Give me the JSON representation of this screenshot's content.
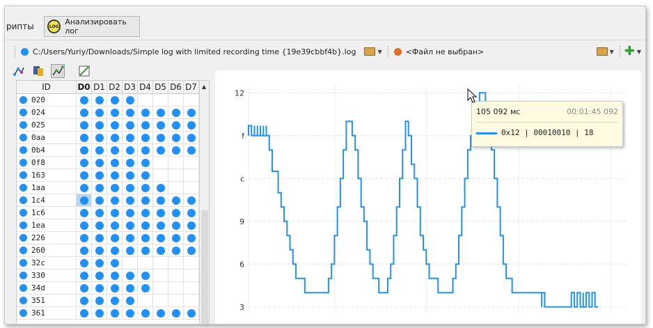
{
  "toolbar": {
    "scripts_label": "рипты",
    "analyze_label": "Анализировать лог",
    "analyze_icon_text": "LOG"
  },
  "pathbar": {
    "file1_path": "C:/Users/Yuriy/Downloads/Simple log with limited recording time {19e39cbbf4b}.log",
    "file1_color": "#1e90ff",
    "file2_label": "<Файл не выбран>",
    "file2_color": "#e07020"
  },
  "table": {
    "headers": [
      "ID",
      "D0",
      "D1",
      "D2",
      "D3",
      "D4",
      "D5",
      "D6",
      "D7"
    ],
    "rows": [
      {
        "id": "020",
        "bits": [
          1,
          1,
          1,
          1,
          0,
          0,
          0,
          0
        ]
      },
      {
        "id": "024",
        "bits": [
          1,
          1,
          1,
          1,
          1,
          1,
          1,
          1
        ]
      },
      {
        "id": "025",
        "bits": [
          1,
          1,
          1,
          1,
          1,
          1,
          1,
          1
        ]
      },
      {
        "id": "0aa",
        "bits": [
          1,
          1,
          1,
          1,
          1,
          1,
          1,
          1
        ]
      },
      {
        "id": "0b4",
        "bits": [
          1,
          1,
          1,
          1,
          1,
          1,
          1,
          1
        ]
      },
      {
        "id": "0f8",
        "bits": [
          1,
          1,
          1,
          1,
          1,
          0,
          0,
          0
        ]
      },
      {
        "id": "163",
        "bits": [
          1,
          1,
          1,
          1,
          1,
          0,
          0,
          0
        ]
      },
      {
        "id": "1aa",
        "bits": [
          1,
          1,
          1,
          1,
          1,
          1,
          0,
          0
        ]
      },
      {
        "id": "1c4",
        "bits": [
          1,
          1,
          1,
          1,
          1,
          1,
          1,
          1
        ],
        "highlight_col": 0
      },
      {
        "id": "1c6",
        "bits": [
          1,
          1,
          1,
          1,
          1,
          1,
          1,
          1
        ]
      },
      {
        "id": "1ea",
        "bits": [
          1,
          1,
          1,
          1,
          1,
          1,
          1,
          1
        ]
      },
      {
        "id": "226",
        "bits": [
          1,
          1,
          1,
          1,
          1,
          1,
          1,
          1
        ]
      },
      {
        "id": "260",
        "bits": [
          1,
          1,
          1,
          1,
          1,
          1,
          1,
          1
        ]
      },
      {
        "id": "32c",
        "bits": [
          1,
          1,
          1,
          0,
          0,
          0,
          0,
          0
        ]
      },
      {
        "id": "330",
        "bits": [
          1,
          1,
          1,
          1,
          1,
          0,
          0,
          0
        ]
      },
      {
        "id": "34d",
        "bits": [
          1,
          1,
          1,
          1,
          1,
          0,
          0,
          0
        ]
      },
      {
        "id": "351",
        "bits": [
          1,
          1,
          1,
          1,
          0,
          0,
          0,
          0
        ]
      },
      {
        "id": "361",
        "bits": [
          1,
          1,
          1,
          1,
          1,
          1,
          1,
          1
        ]
      }
    ]
  },
  "tooltip": {
    "time_ms": "105 092 мс",
    "timestamp": "00:01:45 092",
    "value_text": "0x12 | 00010010 | 18"
  },
  "chart_data": {
    "type": "line",
    "title": "",
    "xlabel": "",
    "ylabel": "",
    "ylim": [
      2.5,
      12.5
    ],
    "yticks": [
      {
        "value": 12,
        "label": "12"
      },
      {
        "value": 9,
        "label": "f"
      },
      {
        "value": 6,
        "label": "c"
      },
      {
        "value": 3,
        "label": "9"
      },
      {
        "value": 0,
        "label": "6"
      },
      {
        "value": -3,
        "label": "3"
      }
    ],
    "series": [
      {
        "color": "#1e90ff",
        "points": [
          [
            0,
            9.7
          ],
          [
            0,
            9
          ],
          [
            0,
            9.7
          ],
          [
            0,
            9
          ],
          [
            0,
            9.7
          ],
          [
            1,
            9
          ],
          [
            2,
            9.7
          ],
          [
            2,
            9
          ],
          [
            3,
            9.7
          ],
          [
            3,
            9
          ],
          [
            4,
            9.7
          ],
          [
            4,
            9
          ],
          [
            5,
            9.7
          ],
          [
            5,
            9
          ],
          [
            6,
            9.7
          ],
          [
            6,
            9
          ],
          [
            7,
            9
          ],
          [
            7,
            8
          ],
          [
            8,
            8
          ],
          [
            8,
            6.5
          ],
          [
            9,
            6.5
          ],
          [
            10,
            5
          ],
          [
            11,
            4
          ],
          [
            12,
            3
          ],
          [
            13,
            2
          ],
          [
            14,
            1
          ],
          [
            15,
            0
          ],
          [
            16,
            -1
          ],
          [
            18,
            -1
          ],
          [
            19,
            -2
          ],
          [
            21,
            -2
          ],
          [
            22,
            -2
          ],
          [
            23,
            -2
          ],
          [
            26,
            -2
          ],
          [
            27,
            -1
          ],
          [
            28,
            0
          ],
          [
            29,
            2
          ],
          [
            30,
            4
          ],
          [
            31,
            6
          ],
          [
            32,
            8
          ],
          [
            33,
            9
          ],
          [
            33,
            10
          ],
          [
            34,
            10
          ],
          [
            35,
            9
          ],
          [
            36,
            8
          ],
          [
            37,
            6
          ],
          [
            38,
            4
          ],
          [
            39,
            3
          ],
          [
            40,
            1
          ],
          [
            41,
            0
          ],
          [
            42,
            -1
          ],
          [
            43,
            -1
          ],
          [
            44,
            -2
          ],
          [
            45,
            -2
          ],
          [
            46,
            -2
          ],
          [
            47,
            -1
          ],
          [
            48,
            0
          ],
          [
            49,
            2
          ],
          [
            50,
            4
          ],
          [
            51,
            6
          ],
          [
            52,
            8
          ],
          [
            53,
            9
          ],
          [
            53,
            10
          ],
          [
            54,
            10
          ],
          [
            54,
            9
          ],
          [
            55,
            7
          ],
          [
            56,
            6
          ],
          [
            57,
            4
          ],
          [
            58,
            2
          ],
          [
            59,
            1
          ],
          [
            60,
            0
          ],
          [
            61,
            -1
          ],
          [
            63,
            -1
          ],
          [
            64,
            -2
          ],
          [
            66,
            -2
          ],
          [
            67,
            -2
          ],
          [
            68,
            -2
          ],
          [
            69,
            -1
          ],
          [
            70,
            0
          ],
          [
            71,
            2
          ],
          [
            72,
            4
          ],
          [
            73,
            6
          ],
          [
            74,
            8
          ],
          [
            75,
            9
          ],
          [
            76,
            10
          ],
          [
            77,
            11
          ],
          [
            78,
            12
          ],
          [
            79,
            12
          ],
          [
            80,
            11
          ],
          [
            81,
            10
          ],
          [
            82,
            8
          ],
          [
            83,
            6
          ],
          [
            84,
            4
          ],
          [
            85,
            2
          ],
          [
            86,
            0
          ],
          [
            87,
            -1
          ],
          [
            88,
            -1
          ],
          [
            89,
            -2
          ],
          [
            91,
            -2
          ],
          [
            92,
            -2
          ],
          [
            93,
            -2
          ],
          [
            94,
            -2
          ],
          [
            95,
            -2
          ],
          [
            96,
            -2
          ],
          [
            97,
            -2
          ],
          [
            98,
            -2
          ],
          [
            99,
            -3
          ],
          [
            99,
            -2
          ],
          [
            100,
            -3
          ],
          [
            101,
            -3
          ],
          [
            102,
            -3
          ],
          [
            103,
            -3
          ],
          [
            104,
            -3
          ],
          [
            105,
            -3
          ],
          [
            106,
            -3
          ],
          [
            107,
            -3
          ],
          [
            108,
            -3
          ],
          [
            109,
            -3
          ],
          [
            109,
            -2
          ],
          [
            110,
            -2
          ],
          [
            110,
            -3
          ],
          [
            111,
            -2
          ],
          [
            112,
            -3
          ],
          [
            113,
            -2
          ],
          [
            113,
            -3
          ],
          [
            114,
            -2
          ],
          [
            115,
            -3
          ],
          [
            116,
            -2
          ],
          [
            117,
            -3
          ],
          [
            118,
            -3
          ]
        ]
      }
    ]
  }
}
